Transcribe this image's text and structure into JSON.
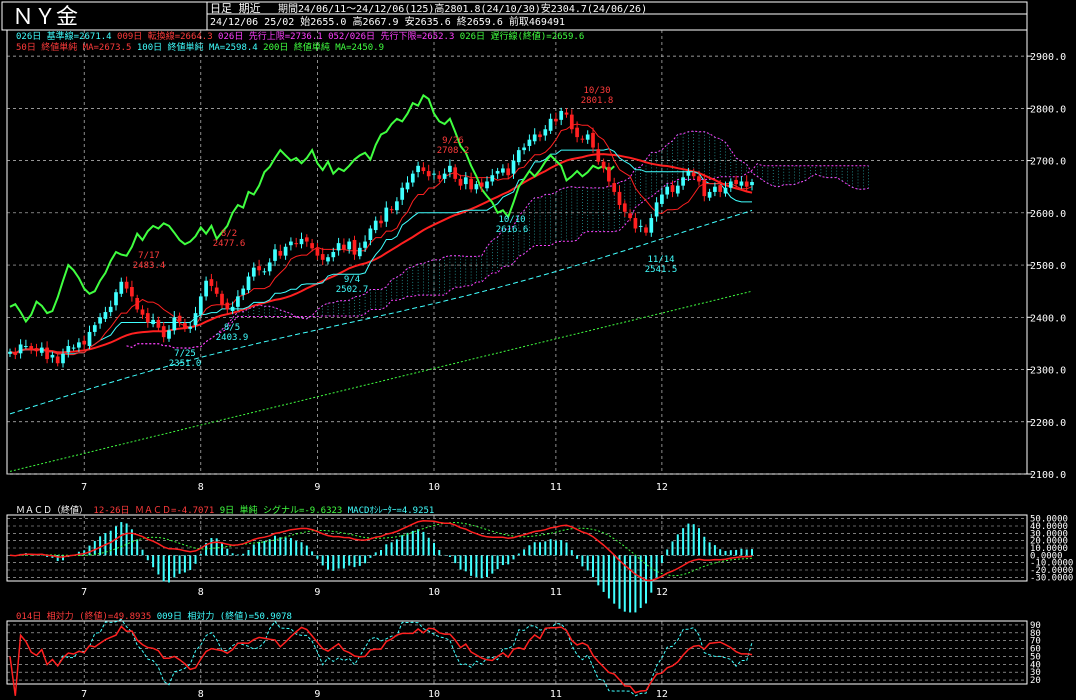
{
  "header": {
    "title": "ＮＹ金",
    "mode": "日足 期近",
    "period_info": "期間24/06/11～24/12/06(125)高2801.8(24/10/30)安2304.7(24/06/26)",
    "last_bar_info": "24/12/06 25/02 始2655.0 高2667.9 安2635.6 終2659.6 前取469491"
  },
  "legends": {
    "row1": [
      {
        "text": "026日 基準線=2671.4",
        "color": "#40ffff"
      },
      {
        "text": "009日 転換線=2664.3",
        "color": "#ff3b3b"
      },
      {
        "text": "026日 先行上限=2736.1",
        "color": "#ff40ff"
      },
      {
        "text": "052/026日 先行下限=2652.3",
        "color": "#ff40ff"
      },
      {
        "text": "026日 遅行線(終値)=2659.6",
        "color": "#40ff40"
      }
    ],
    "row2": [
      {
        "text": "50日 終値単純 MA=2673.5",
        "color": "#ff3b3b"
      },
      {
        "text": "100日 終値単純 MA=2598.4",
        "color": "#40ffff"
      },
      {
        "text": "200日 終値単純 MA=2450.9",
        "color": "#40ff40"
      }
    ]
  },
  "macd_legend": [
    {
      "text": "ＭＡＣＤ（終値）",
      "color": "#ffffff"
    },
    {
      "text": "12-26日 ＭＡＣＤ=-4.7071",
      "color": "#ff3b3b"
    },
    {
      "text": "9日 単純 シグナル=-9.6323",
      "color": "#40ff40"
    },
    {
      "text": "MACDｵｼﾚｰﾀｰ=4.9251",
      "color": "#40ffff"
    }
  ],
  "rsi_legend": [
    {
      "text": "014日 相対力 (終値)=49.8935",
      "color": "#ff3b3b"
    },
    {
      "text": "009日 相対力 (終値)=50.9078",
      "color": "#40ffff"
    }
  ],
  "colors": {
    "up": "#40ffff",
    "down": "#ff2020",
    "ma50": "#ff2020",
    "ma100": "#40ffff",
    "ma200": "#40ff40",
    "chikou": "#40ff40",
    "tenkan": "#ff2020",
    "kijun": "#40ffff",
    "cloud": "#ff40ff",
    "grid": "#c8c8c8"
  },
  "chart_data": [
    {
      "type": "candlestick",
      "ylim": [
        2100,
        2950
      ],
      "y_ticks": [
        "2900.0",
        "2800.0",
        "2700.0",
        "2600.0",
        "2500.0",
        "2400.0",
        "2300.0",
        "2200.0",
        "2100.0"
      ],
      "x_month_labels": [
        "7",
        "8",
        "9",
        "10",
        "11",
        "12"
      ],
      "annotations": [
        {
          "text": "10/30",
          "sub": "2801.8"
        },
        {
          "text": "9/26",
          "sub": "2708.2"
        },
        {
          "text": "7/17",
          "sub": "2483.4"
        },
        {
          "text": "8/2",
          "sub": "2477.6"
        },
        {
          "text": "10/10",
          "sub": "2616.6"
        },
        {
          "text": "9/4",
          "sub": "2502.7"
        },
        {
          "text": "8/5",
          "sub": "2403.9"
        },
        {
          "text": "7/25",
          "sub": "2351.0"
        },
        {
          "text": "11/14",
          "sub": "2541.5"
        }
      ],
      "closes": [
        2334,
        2328,
        2348,
        2345,
        2338,
        2335,
        2342,
        2320,
        2328,
        2312,
        2330,
        2345,
        2342,
        2352,
        2348,
        2372,
        2385,
        2400,
        2410,
        2420,
        2448,
        2468,
        2455,
        2440,
        2415,
        2405,
        2390,
        2395,
        2380,
        2362,
        2375,
        2400,
        2392,
        2378,
        2382,
        2408,
        2440,
        2470,
        2460,
        2445,
        2425,
        2415,
        2420,
        2440,
        2455,
        2478,
        2495,
        2490,
        2488,
        2505,
        2530,
        2518,
        2535,
        2545,
        2540,
        2550,
        2545,
        2532,
        2518,
        2510,
        2515,
        2525,
        2542,
        2530,
        2545,
        2520,
        2533,
        2545,
        2570,
        2585,
        2580,
        2610,
        2605,
        2622,
        2648,
        2658,
        2675,
        2690,
        2680,
        2670,
        2675,
        2665,
        2675,
        2690,
        2665,
        2652,
        2668,
        2645,
        2655,
        2650,
        2660,
        2672,
        2680,
        2685,
        2672,
        2700,
        2720,
        2725,
        2740,
        2750,
        2745,
        2760,
        2780,
        2775,
        2795,
        2788,
        2760,
        2745,
        2740,
        2750,
        2725,
        2698,
        2685,
        2660,
        2640,
        2615,
        2602,
        2590,
        2570,
        2575,
        2562,
        2590,
        2620,
        2635,
        2650,
        2640,
        2652,
        2668,
        2680,
        2670,
        2660,
        2632,
        2640,
        2650,
        2640,
        2648,
        2660,
        2655,
        2660,
        2650,
        2659
      ],
      "chikou_start_index": 0
    },
    {
      "type": "macd",
      "ylim": [
        -35,
        55
      ],
      "y_ticks": [
        "50.0000",
        "40.0000",
        "30.0000",
        "20.0000",
        "10.0000",
        "0.0000",
        "-10.0000",
        "-20.0000",
        "-30.0000"
      ]
    },
    {
      "type": "rsi",
      "ylim": [
        15,
        95
      ],
      "y_ticks": [
        "90",
        "80",
        "70",
        "60",
        "50",
        "40",
        "30",
        "20"
      ]
    }
  ]
}
